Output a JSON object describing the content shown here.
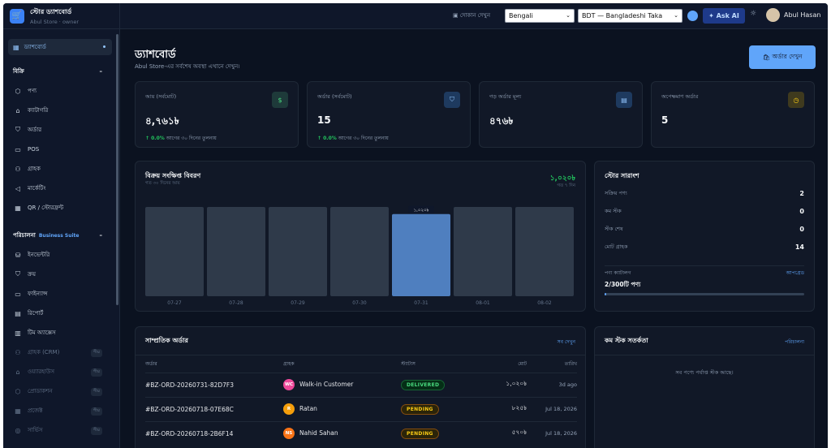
{
  "brand": {
    "name": "স্টোর ড্যাশবোর্ড",
    "sub": "Abul Store · owner",
    "logo_icon": "cart-icon"
  },
  "sidebar": {
    "active": {
      "label": "ড্যাশবোর্ড",
      "icon": "grid-icon"
    },
    "sections": [
      {
        "title": "বিক্রি",
        "items": [
          {
            "label": "পণ্য",
            "icon": "cube-icon"
          },
          {
            "label": "ক্যাটাগরি",
            "icon": "tag-icon"
          },
          {
            "label": "অর্ডার",
            "icon": "bag-icon"
          },
          {
            "label": "POS",
            "icon": "register-icon"
          },
          {
            "label": "গ্রাহক",
            "icon": "users-icon"
          },
          {
            "label": "মার্কেটিং",
            "icon": "megaphone-icon"
          },
          {
            "label": "QR / স্টোরফ্রন্ট",
            "icon": "qr-icon"
          }
        ]
      },
      {
        "title": "পরিচালনা",
        "badge": "Business Suite",
        "items": [
          {
            "label": "ইনভেন্টরি",
            "icon": "database-icon"
          },
          {
            "label": "ক্রয়",
            "icon": "bag-icon"
          },
          {
            "label": "ফাইন্যান্স",
            "icon": "wallet-icon"
          },
          {
            "label": "রিপোর্ট",
            "icon": "report-icon"
          },
          {
            "label": "টিম অ্যাক্সেস",
            "icon": "team-icon"
          },
          {
            "label": "গ্রাহক (CRM)",
            "icon": "users-icon",
            "tag": "শীঘ্র"
          },
          {
            "label": "ওয়্যারহাউস",
            "icon": "warehouse-icon",
            "tag": "শীঘ্র"
          },
          {
            "label": "প্রোডাকশন",
            "icon": "cube-icon",
            "tag": "শীঘ্র"
          },
          {
            "label": "প্রজেক্ট",
            "icon": "grid-icon",
            "tag": "শীঘ্র"
          },
          {
            "label": "সার্ভিস",
            "icon": "service-icon",
            "tag": "শীঘ্র"
          }
        ]
      }
    ]
  },
  "topbar": {
    "view_label": "দোকান দেখুন",
    "language": "Bengali",
    "currency": "BDT — Bangladeshi Taka",
    "ask_ai": "Ask AI",
    "user": "Abul Hasan"
  },
  "page": {
    "title": "ড্যাশবোর্ড",
    "subtitle": "Abul Store-এর সর্বশেষ অবস্থা এখানে দেখুন।",
    "orders_button": "অর্ডার দেখুন"
  },
  "stats": [
    {
      "label": "আয় (সর্বমোট)",
      "value": "৪,৭৬১৳",
      "change": "0.0%",
      "note": "আগের ৩০ দিনের তুলনায়",
      "icon": "dollar-icon"
    },
    {
      "label": "অর্ডার (সর্বমোট)",
      "value": "15",
      "change": "0.0%",
      "note": "আগের ৩০ দিনের তুলনায়",
      "icon": "bag-icon"
    },
    {
      "label": "গড় অর্ডার মূল্য",
      "value": "৪৭৬৳",
      "icon": "receipt-icon"
    },
    {
      "label": "অপেক্ষমাণ অর্ডার",
      "value": "5",
      "icon": "clock-icon"
    }
  ],
  "sales": {
    "title": "বিক্রয় সংক্ষিপ্ত বিবরণ",
    "subtitle": "গত ৩০ দিনের আয়",
    "total": "১,০২০৳",
    "total_note": "গত ৭ দিন",
    "chart_data": {
      "type": "bar",
      "categories": [
        "07-27",
        "07-28",
        "07-29",
        "07-30",
        "07-31",
        "08-01",
        "08-02"
      ],
      "values": [
        0,
        0,
        0,
        0,
        1020,
        0,
        0
      ],
      "highlight_index": 4,
      "highlight_label": "১,০২০৳",
      "colors": {
        "highlight": "#4f7fbf",
        "other": "#2f3a4a"
      }
    }
  },
  "summary": {
    "title": "স্টোর সারাংশ",
    "rows": [
      {
        "label": "সক্রিয় পণ্য",
        "value": "2"
      },
      {
        "label": "কম স্টক",
        "value": "0"
      },
      {
        "label": "স্টক শেষ",
        "value": "0"
      },
      {
        "label": "মোট গ্রাহক",
        "value": "14"
      }
    ],
    "catalog_label": "পণ্য ক্যাটালগ",
    "catalog_link": "আপগ্রেড",
    "catalog_value": "2/300টি পণ্য",
    "catalog_progress": 0.0067
  },
  "recent": {
    "title": "সাম্প্রতিক অর্ডার",
    "link": "সব দেখুন",
    "columns": [
      "অর্ডার",
      "গ্রাহক",
      "স্ট্যাটাস",
      "মোট",
      "তারিখ"
    ],
    "rows": [
      {
        "order": "#BZ-ORD-20260731-82D7F3",
        "initials": "WC",
        "avatar_color": "#ec4899",
        "customer": "Walk-in Customer",
        "status": "DELIVERED",
        "total": "১,০২০৳",
        "date": "3d ago"
      },
      {
        "order": "#BZ-ORD-20260718-07E68C",
        "initials": "R",
        "avatar_color": "#f59e0b",
        "customer": "Ratan",
        "status": "PENDING",
        "total": "৮২৫৳",
        "date": "Jul 18, 2026"
      },
      {
        "order": "#BZ-ORD-20260718-2B6F14",
        "initials": "NS",
        "avatar_color": "#f97316",
        "customer": "Nahid Sahan",
        "status": "PENDING",
        "total": "৫৭০৳",
        "date": "Jul 18, 2026"
      }
    ]
  },
  "low_stock": {
    "title": "কম স্টক সতর্কতা",
    "link": "পরিচালনা",
    "message": "সব পণ্যে পর্যাপ্ত স্টক আছে।"
  }
}
